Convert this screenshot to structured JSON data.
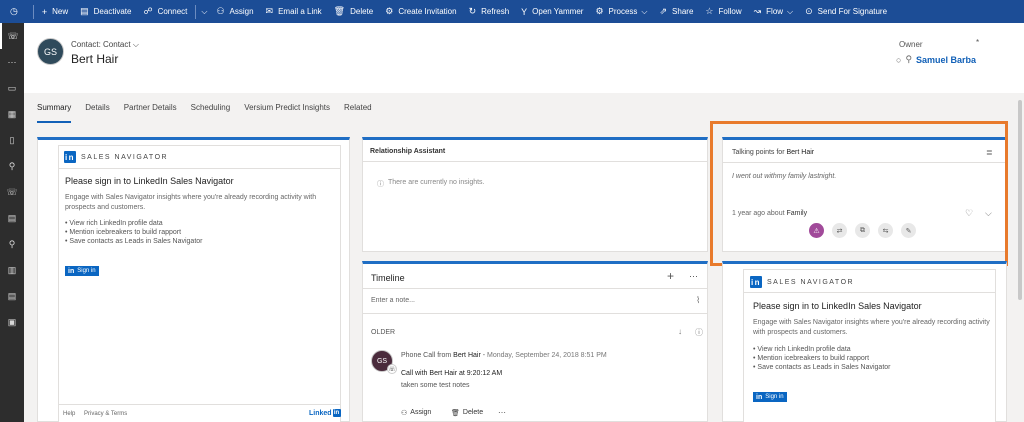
{
  "toolbar": {
    "items": [
      {
        "icon": "clock-icon",
        "label": ""
      },
      {
        "icon": "plus-icon",
        "label": "New"
      },
      {
        "icon": "deactivate-icon",
        "label": "Deactivate"
      },
      {
        "icon": "connect-icon",
        "label": "Connect"
      },
      {
        "icon": "assign-icon",
        "label": "Assign"
      },
      {
        "icon": "email-icon",
        "label": "Email a Link"
      },
      {
        "icon": "delete-icon",
        "label": "Delete"
      },
      {
        "icon": "invitation-icon",
        "label": "Create Invitation"
      },
      {
        "icon": "refresh-icon",
        "label": "Refresh"
      },
      {
        "icon": "yammer-icon",
        "label": "Open Yammer"
      },
      {
        "icon": "process-icon",
        "label": "Process"
      },
      {
        "icon": "share-icon",
        "label": "Share"
      },
      {
        "icon": "star-icon",
        "label": "Follow"
      },
      {
        "icon": "flow-icon",
        "label": "Flow"
      },
      {
        "icon": "signature-icon",
        "label": "Send For Signature"
      }
    ]
  },
  "header": {
    "avatar_initials": "GS",
    "entity_type": "Contact: Contact",
    "record_name": "Bert Hair",
    "owner_label": "Owner",
    "owner_required": "*",
    "owner_name": "Samuel Barba"
  },
  "tabs": [
    "Summary",
    "Details",
    "Partner Details",
    "Scheduling",
    "Versium Predict Insights",
    "Related"
  ],
  "sales_nav_left": {
    "logo": "in",
    "brand": "SALES NAVIGATOR",
    "title": "Please sign in to LinkedIn Sales Navigator",
    "body": "Engage with Sales Navigator insights where you're already recording activity with prospects and customers.",
    "bullets": [
      "View rich LinkedIn profile data",
      "Mention icebreakers to build rapport",
      "Save contacts as Leads in Sales Navigator"
    ],
    "signin_label": "Sign in",
    "footer_help": "Help",
    "footer_privacy": "Privacy & Terms",
    "footer_brand": "Linked"
  },
  "relationship_assistant": {
    "title": "Relationship Assistant",
    "empty_message": "There are currently no insights."
  },
  "talking_points": {
    "title_prefix": "Talking points for",
    "title_name": "Bert Hair",
    "quote": "I went out withmy family lastnight.",
    "meta": "1 year ago about",
    "meta_topic": "Family"
  },
  "timeline": {
    "title": "Timeline",
    "note_placeholder": "Enter a note...",
    "section": "OLDER",
    "entry": {
      "type": "Phone Call from",
      "from_name": "Bert Hair",
      "date": "Monday, September 24, 2018 8:51 PM",
      "subject_prefix": "Call with",
      "subject_name": "Bert Hair",
      "subject_suffix": "at 9:20:12 AM",
      "note": "taken some test notes",
      "assign_label": "Assign",
      "delete_label": "Delete"
    }
  },
  "sales_nav_right": {
    "logo": "in",
    "brand": "SALES NAVIGATOR",
    "title": "Please sign in to LinkedIn Sales Navigator",
    "body": "Engage with Sales Navigator insights where you're already recording activity with prospects and customers.",
    "bullets": [
      "View rich LinkedIn profile data",
      "Mention icebreakers to build rapport",
      "Save contacts as Leads in Sales Navigator"
    ],
    "signin_label": "Sign in"
  },
  "colors": {
    "topbar": "#1c4d96",
    "accent": "#1f6ec4",
    "highlight": "#e87a2c",
    "linkedin": "#0a66c2"
  }
}
